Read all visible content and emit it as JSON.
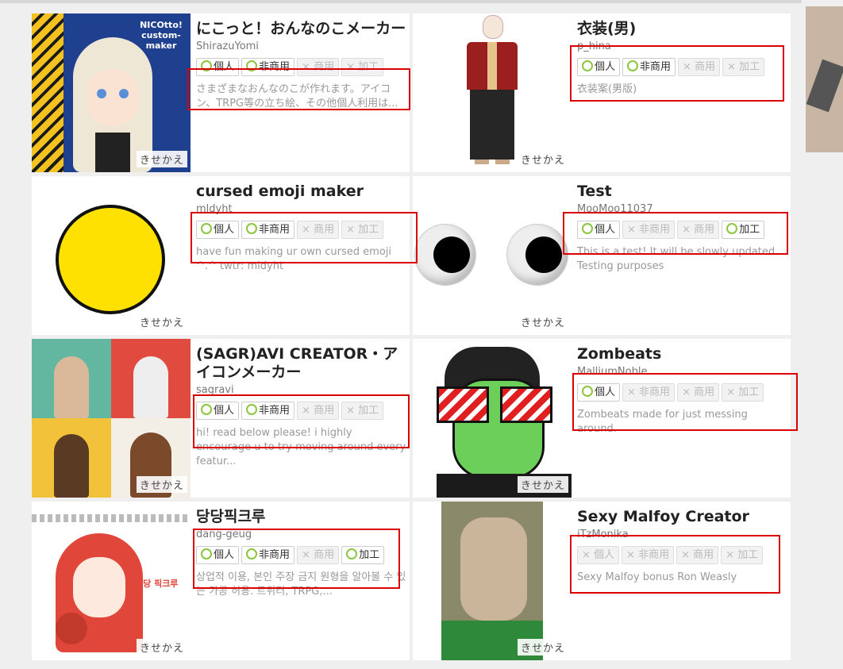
{
  "thumb_label": "きせかえ",
  "cards": [
    {
      "title": "にこっと！おんなのこメーカー",
      "author": "ShirazuYomi",
      "tags": [
        {
          "label": "個人",
          "on": true
        },
        {
          "label": "非商用",
          "on": true
        },
        {
          "label": "商用",
          "on": false
        },
        {
          "label": "加工",
          "on": false
        }
      ],
      "desc": "さまざまなおんなのこが作れます。アイコン、TRPG等の立ち絵、その他個人利用は...",
      "thumb_text": "NICOtto! custom-maker"
    },
    {
      "title": "衣装(男)",
      "author": "p_hina",
      "tags": [
        {
          "label": "個人",
          "on": true
        },
        {
          "label": "非商用",
          "on": true
        },
        {
          "label": "商用",
          "on": false
        },
        {
          "label": "加工",
          "on": false
        }
      ],
      "desc": "衣装案(男版)"
    },
    {
      "title": "cursed emoji maker",
      "author": "mldyht",
      "tags": [
        {
          "label": "個人",
          "on": true
        },
        {
          "label": "非商用",
          "on": true
        },
        {
          "label": "商用",
          "on": false
        },
        {
          "label": "加工",
          "on": false
        }
      ],
      "desc": "have fun making ur own cursed emoji ^.^ twtr: mldyht"
    },
    {
      "title": "Test",
      "author": "MooMoo11037",
      "tags": [
        {
          "label": "個人",
          "on": true
        },
        {
          "label": "非商用",
          "on": false
        },
        {
          "label": "商用",
          "on": false
        },
        {
          "label": "加工",
          "on": true
        }
      ],
      "desc": "This is a test! It will be slowly updated. Testing purposes"
    },
    {
      "title": "(SAGR)AVI CREATOR・アイコンメーカー",
      "author": "sagravi",
      "tags": [
        {
          "label": "個人",
          "on": true
        },
        {
          "label": "非商用",
          "on": true
        },
        {
          "label": "商用",
          "on": false
        },
        {
          "label": "加工",
          "on": false
        }
      ],
      "desc": "hi! read below please! i highly encourage u to try moving around every featur..."
    },
    {
      "title": "Zombeats",
      "author": "MalliumNoble",
      "tags": [
        {
          "label": "個人",
          "on": true
        },
        {
          "label": "非商用",
          "on": false
        },
        {
          "label": "商用",
          "on": false
        },
        {
          "label": "加工",
          "on": false
        }
      ],
      "desc": "Zombeats made for just messing around."
    },
    {
      "title": "당당픽크루",
      "author": "dang-geug",
      "tags": [
        {
          "label": "個人",
          "on": true
        },
        {
          "label": "非商用",
          "on": true
        },
        {
          "label": "商用",
          "on": false
        },
        {
          "label": "加工",
          "on": true
        }
      ],
      "desc": "상업적 이용, 본인 주장 금지 원형을 알아볼 수 있는 가공 허용. 트위터, TRPG,...",
      "thumb_text": "당당 픽크루"
    },
    {
      "title": "Sexy Malfoy Creator",
      "author": "iTzMonika",
      "tags": [
        {
          "label": "個人",
          "on": false
        },
        {
          "label": "非商用",
          "on": false
        },
        {
          "label": "商用",
          "on": false
        },
        {
          "label": "加工",
          "on": false
        }
      ],
      "desc": "Sexy Malfoy bonus Ron Weasly"
    }
  ],
  "colors": {
    "highlight": "#dd0000",
    "tag_on_ring": "#8cc63f"
  }
}
